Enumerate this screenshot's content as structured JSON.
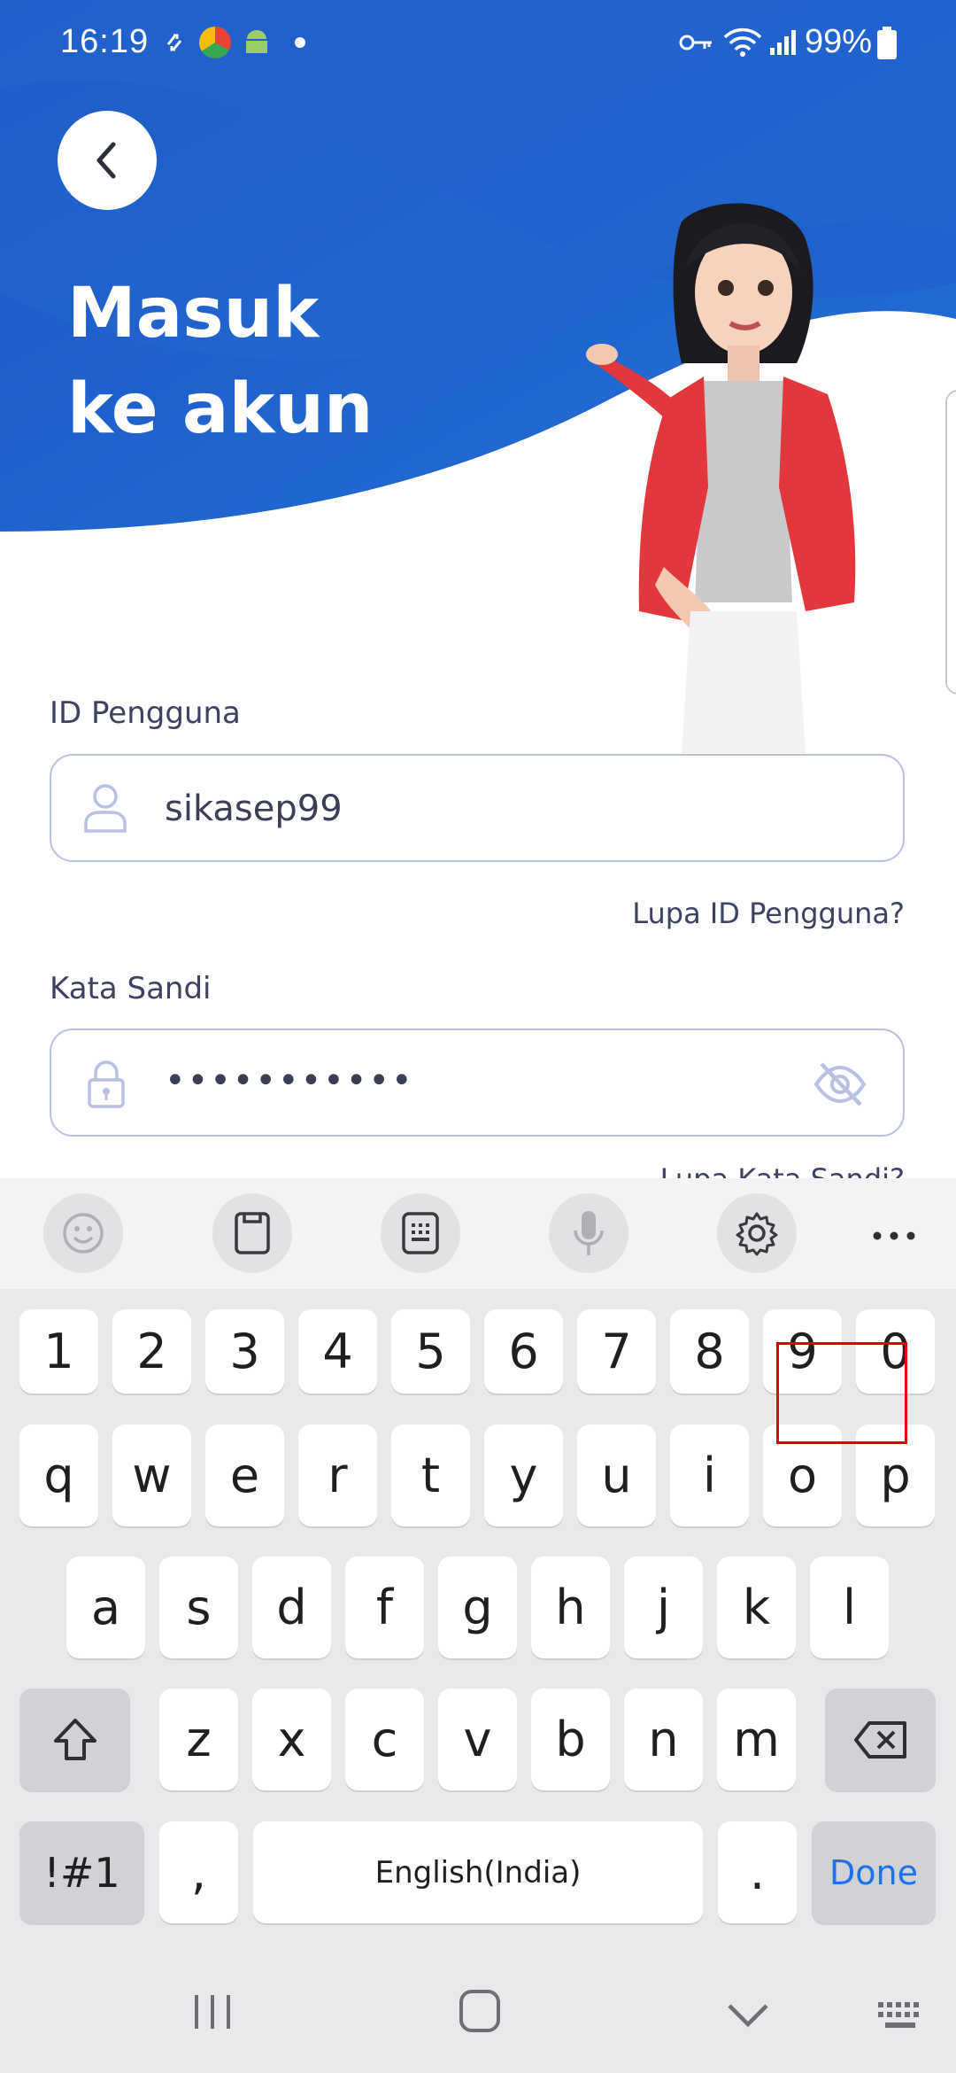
{
  "status_bar": {
    "time": "16:19",
    "battery": "99%"
  },
  "page": {
    "title_line1": "Masuk",
    "title_line2": "ke akun"
  },
  "user_id": {
    "label": "ID Pengguna",
    "value": "sikasep99",
    "forgot": "Lupa ID Pengguna?"
  },
  "password": {
    "label": "Kata Sandi",
    "value": "•••••••••••",
    "forgot": "Lupa Kata Sandi?"
  },
  "keyboard": {
    "row_numbers": [
      "1",
      "2",
      "3",
      "4",
      "5",
      "6",
      "7",
      "8",
      "9",
      "0"
    ],
    "row1": [
      "q",
      "w",
      "e",
      "r",
      "t",
      "y",
      "u",
      "i",
      "o",
      "p"
    ],
    "row2": [
      "a",
      "s",
      "d",
      "f",
      "g",
      "h",
      "j",
      "k",
      "l"
    ],
    "row3": [
      "z",
      "x",
      "c",
      "v",
      "b",
      "n",
      "m"
    ],
    "symbols": "!#1",
    "comma": ",",
    "space": "English(India)",
    "period": ".",
    "done": "Done"
  },
  "colors": {
    "brand_blue": "#1e62c8",
    "done_blue": "#1a73e8",
    "highlight": "#e00000"
  },
  "icons": [
    "back-icon",
    "user-icon",
    "lock-icon",
    "eye-off-icon",
    "emoji-icon",
    "clipboard-icon",
    "keypad-icon",
    "mic-icon",
    "settings-icon",
    "more-icon",
    "shift-icon",
    "backspace-icon",
    "recents-icon",
    "home-icon",
    "back-nav-icon",
    "keyboard-icon"
  ]
}
